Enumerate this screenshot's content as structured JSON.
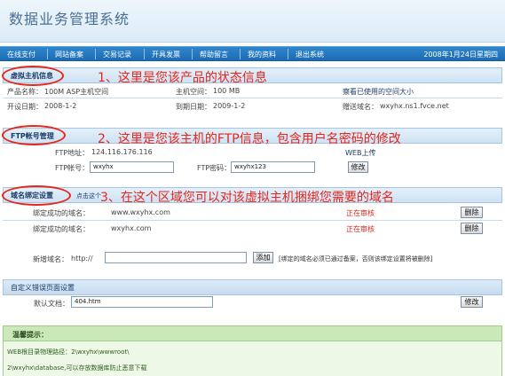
{
  "app": {
    "title": "数据业务管理系统"
  },
  "nav": {
    "items": [
      "在线支付",
      "网站备案",
      "交易记录",
      "开具发票",
      "帮助留言",
      "我的资料",
      "退出系统"
    ],
    "date": "2008年1月24日星期四"
  },
  "annotations": {
    "a1": "1、这里是您该产品的状态信息",
    "a2": "2、这里是您该主机的FTP信息，包含用户名密码的修改",
    "a3": "3、在这个区域您可以对该虚拟主机捆绑您需要的域名"
  },
  "host": {
    "section_label": "虚拟主机信息",
    "product_label": "产品名称：",
    "product_value": "100M ASP主机空间",
    "space_label": "主机空间：",
    "space_value": "100 MB",
    "view_used": "察看已使用的空间大小",
    "open_label": "开设日期：",
    "open_value": "2008-1-2",
    "expire_label": "到期日期：",
    "expire_value": "2009-1-2",
    "gift_label": "赠送域名：",
    "gift_value": "wxyhx.ns1.fvce.net"
  },
  "ftp": {
    "section_label": "FTP帐号管理",
    "address_label": "FTP地址：",
    "address_value": "124.116.176.116",
    "upload_link": "WEB上传",
    "account_label": "FTP帐号：",
    "account_value": "wxyhx",
    "password_label": "FTP密码：",
    "password_value": "wxyhx123",
    "modify_button": "修改"
  },
  "domain": {
    "section_label": "域名绑定设置",
    "hint_text": "点击这个",
    "bound": [
      {
        "label": "绑定成功的域名：",
        "domain": "www.wxyhx.com",
        "status": "正在审核",
        "action": "删除"
      },
      {
        "label": "绑定成功的域名：",
        "domain": "wxyhx.com",
        "status": "正在审核",
        "action": "删除"
      }
    ],
    "new_label": "新增域名：",
    "prefix": "http://",
    "new_value": "",
    "add_button": "添加",
    "notice": "[绑定的域名必须已通过备案，否则该绑定设置将被删除]"
  },
  "errorpage": {
    "section_label": "自定义错误页面设置",
    "default_label": "默认文档：",
    "default_value": "404.htm",
    "modify_button": "修改"
  },
  "tips": {
    "title": "温馨提示：",
    "line1": "WEB根目录物理路径：2\\wxyhx\\wwwroot\\",
    "line2": "2\\wxyhx\\database,可以存放数据库防止恶意下载"
  },
  "colors": {
    "nav": "#1c6cb5",
    "annotation": "#e6261b",
    "status": "#d8291f",
    "tips_bg": "#c9eab8"
  }
}
